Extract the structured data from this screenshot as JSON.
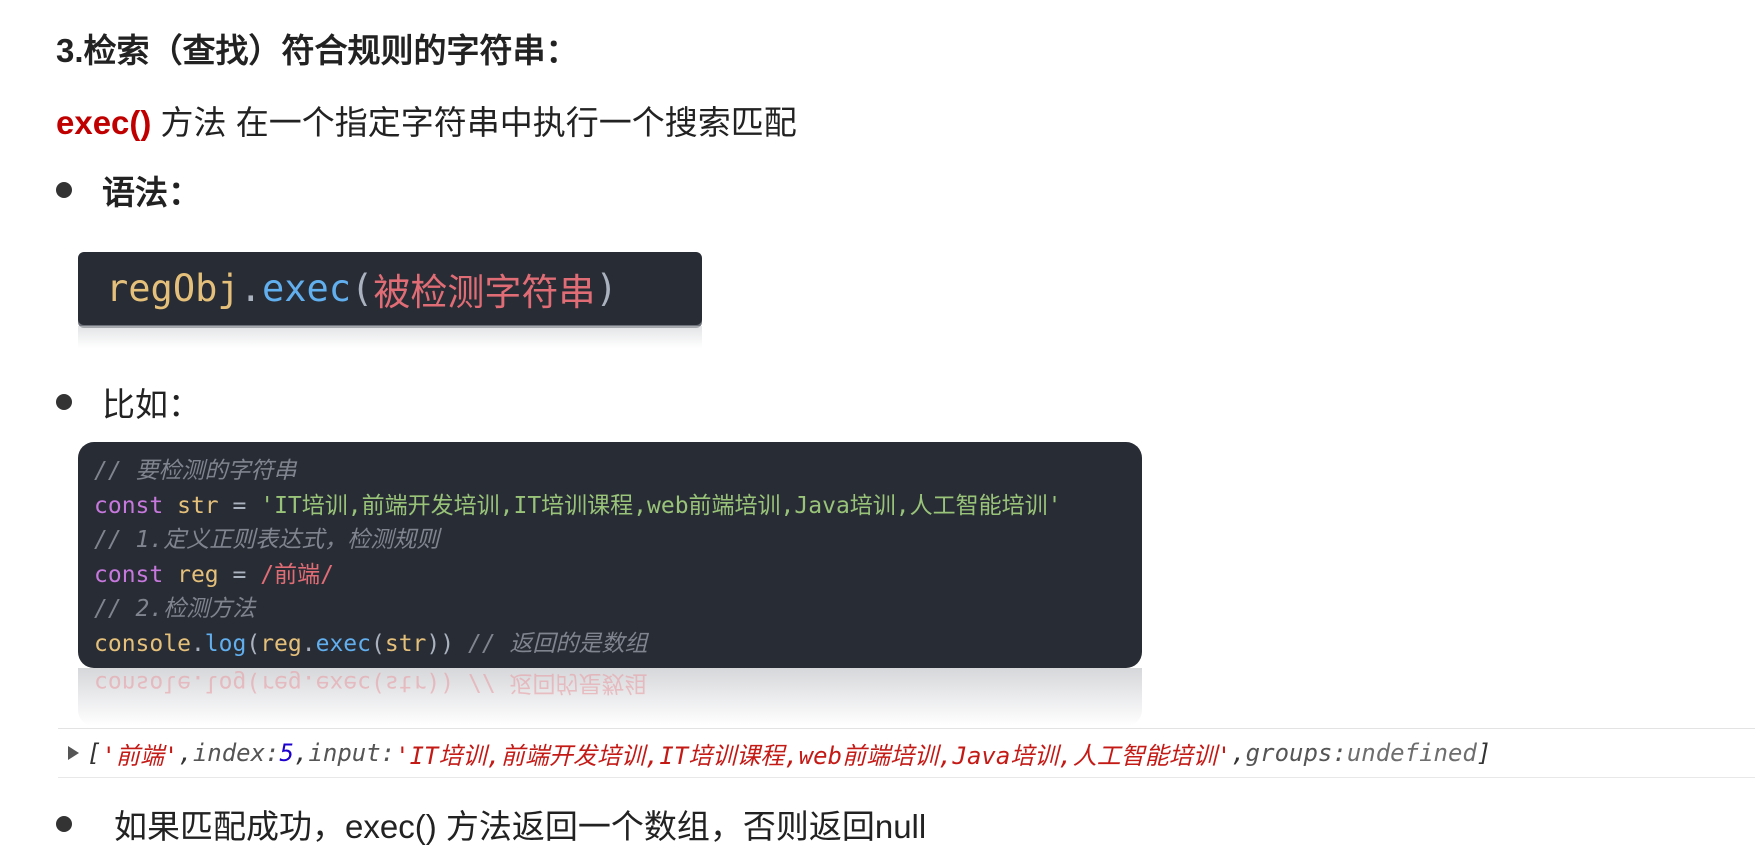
{
  "heading": "3.检索（查找）符合规则的字符串：",
  "intro": {
    "method": "exec()",
    "text": " 方法 在一个指定字符串中执行一个搜索匹配"
  },
  "bullets": {
    "syntax_label": "语法：",
    "example_label": "比如：",
    "note": "如果匹配成功，exec() 方法返回一个数组，否则返回null"
  },
  "syntax_code": {
    "obj": "regObj",
    "dot": ".",
    "method": "exec",
    "open": "(",
    "arg": "被检测字符串",
    "close": ")"
  },
  "code_lines": {
    "l1_comment": "// 要检测的字符串",
    "l2_kw": "const",
    "l2_var": "str",
    "l2_eq": "=",
    "l2_str": "'IT培训,前端开发培训,IT培训课程,web前端培训,Java培训,人工智能培训'",
    "l3_comment": "// 1.定义正则表达式，检测规则",
    "l4_kw": "const",
    "l4_var": "reg",
    "l4_eq": "=",
    "l4_regex": "/前端/",
    "l5_comment": "// 2.检测方法",
    "l6_obj": "console",
    "l6_dot1": ".",
    "l6_log": "log",
    "l6_p1": "(",
    "l6_reg": "reg",
    "l6_dot2": ".",
    "l6_exec": "exec",
    "l6_p2": "(",
    "l6_str": "str",
    "l6_close": "))",
    "l6_comment": "// 返回的是数组"
  },
  "console_output": {
    "open": "[",
    "match": "'前端'",
    "sep1": ", ",
    "index_key": "index: ",
    "index_val": "5",
    "sep2": ", ",
    "input_key": "input: ",
    "input_val": "'IT培训,前端开发培训,IT培训课程,web前端培训,Java培训,人工智能培训'",
    "sep3": ", ",
    "groups_key": "groups: ",
    "groups_val": "undefined",
    "close": "]"
  },
  "colors": {
    "method_highlight": "#c00000",
    "code_background": "#282c34",
    "console_string": "#c41a16",
    "console_number": "#1c00cf"
  }
}
